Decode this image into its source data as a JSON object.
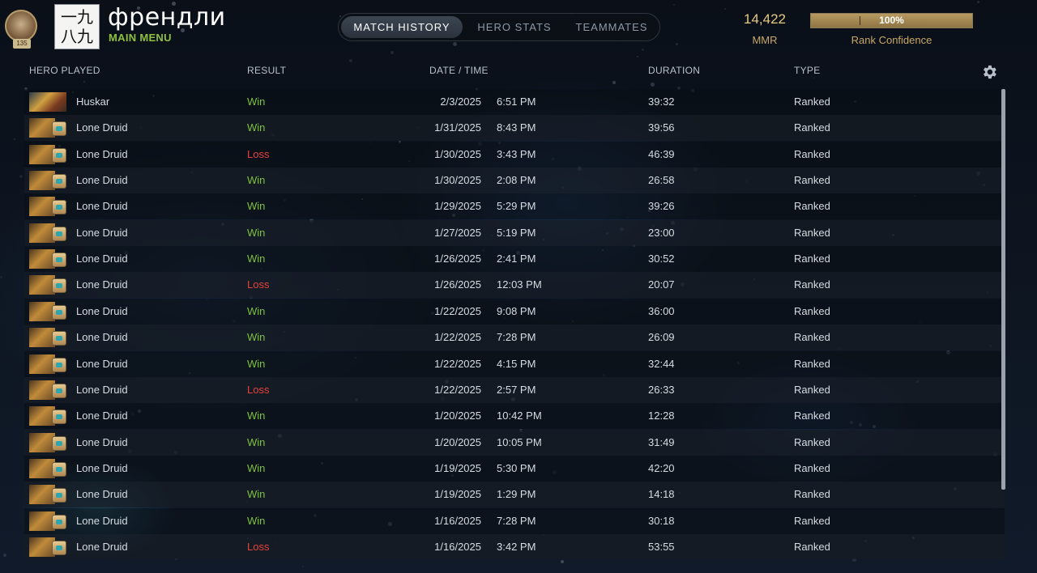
{
  "header": {
    "player_name": "френдли",
    "main_menu_label": "MAIN MENU",
    "avatar_text": "一九八九",
    "rank_medal": {
      "icon": "rank-medal-icon",
      "plate_text": "135"
    }
  },
  "tabs": [
    {
      "label": "MATCH HISTORY",
      "active": true
    },
    {
      "label": "HERO STATS",
      "active": false
    },
    {
      "label": "TEAMMATES",
      "active": false
    }
  ],
  "stats": {
    "mmr_value": "14,422",
    "mmr_label": "MMR",
    "rank_confidence_percent": 100,
    "rank_confidence_text": "100%",
    "rank_confidence_label": "Rank Confidence"
  },
  "columns": {
    "hero": "HERO PLAYED",
    "result": "RESULT",
    "datetime": "DATE / TIME",
    "duration": "DURATION",
    "type": "TYPE"
  },
  "settings_icon": "gear-icon",
  "colors": {
    "win": "#7ec23a",
    "loss": "#e5433a",
    "gold": "#e7c980",
    "menu_green": "#8fbf3f"
  },
  "matches": [
    {
      "hero": "Huskar",
      "result": "Win",
      "date": "2/3/2025",
      "time": "6:51 PM",
      "duration": "39:32",
      "type": "Ranked"
    },
    {
      "hero": "Lone Druid",
      "result": "Win",
      "date": "1/31/2025",
      "time": "8:43 PM",
      "duration": "39:56",
      "type": "Ranked"
    },
    {
      "hero": "Lone Druid",
      "result": "Loss",
      "date": "1/30/2025",
      "time": "3:43 PM",
      "duration": "46:39",
      "type": "Ranked"
    },
    {
      "hero": "Lone Druid",
      "result": "Win",
      "date": "1/30/2025",
      "time": "2:08 PM",
      "duration": "26:58",
      "type": "Ranked"
    },
    {
      "hero": "Lone Druid",
      "result": "Win",
      "date": "1/29/2025",
      "time": "5:29 PM",
      "duration": "39:26",
      "type": "Ranked"
    },
    {
      "hero": "Lone Druid",
      "result": "Win",
      "date": "1/27/2025",
      "time": "5:19 PM",
      "duration": "23:00",
      "type": "Ranked"
    },
    {
      "hero": "Lone Druid",
      "result": "Win",
      "date": "1/26/2025",
      "time": "2:41 PM",
      "duration": "30:52",
      "type": "Ranked"
    },
    {
      "hero": "Lone Druid",
      "result": "Loss",
      "date": "1/26/2025",
      "time": "12:03 PM",
      "duration": "20:07",
      "type": "Ranked"
    },
    {
      "hero": "Lone Druid",
      "result": "Win",
      "date": "1/22/2025",
      "time": "9:08 PM",
      "duration": "36:00",
      "type": "Ranked"
    },
    {
      "hero": "Lone Druid",
      "result": "Win",
      "date": "1/22/2025",
      "time": "7:28 PM",
      "duration": "26:09",
      "type": "Ranked"
    },
    {
      "hero": "Lone Druid",
      "result": "Win",
      "date": "1/22/2025",
      "time": "4:15 PM",
      "duration": "32:44",
      "type": "Ranked"
    },
    {
      "hero": "Lone Druid",
      "result": "Loss",
      "date": "1/22/2025",
      "time": "2:57 PM",
      "duration": "26:33",
      "type": "Ranked"
    },
    {
      "hero": "Lone Druid",
      "result": "Win",
      "date": "1/20/2025",
      "time": "10:42 PM",
      "duration": "12:28",
      "type": "Ranked"
    },
    {
      "hero": "Lone Druid",
      "result": "Win",
      "date": "1/20/2025",
      "time": "10:05 PM",
      "duration": "31:49",
      "type": "Ranked"
    },
    {
      "hero": "Lone Druid",
      "result": "Win",
      "date": "1/19/2025",
      "time": "5:30 PM",
      "duration": "42:20",
      "type": "Ranked"
    },
    {
      "hero": "Lone Druid",
      "result": "Win",
      "date": "1/19/2025",
      "time": "1:29 PM",
      "duration": "14:18",
      "type": "Ranked"
    },
    {
      "hero": "Lone Druid",
      "result": "Win",
      "date": "1/16/2025",
      "time": "7:28 PM",
      "duration": "30:18",
      "type": "Ranked"
    },
    {
      "hero": "Lone Druid",
      "result": "Loss",
      "date": "1/16/2025",
      "time": "3:42 PM",
      "duration": "53:55",
      "type": "Ranked"
    }
  ]
}
